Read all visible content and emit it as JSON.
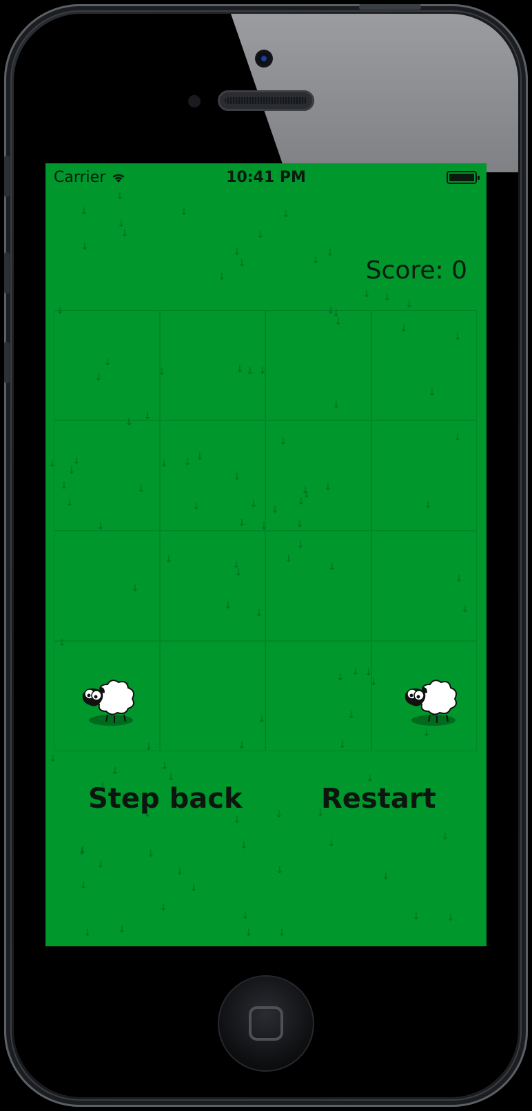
{
  "status_bar": {
    "carrier": "Carrier",
    "time": "10:41 PM",
    "wifi_icon": "wifi-icon",
    "battery_icon": "battery-icon"
  },
  "game": {
    "score_label": "Score: 0",
    "board": {
      "rows": 4,
      "cols": 4
    },
    "sheep_icon": "sheep-icon",
    "background_color": "#00972c"
  },
  "controls": {
    "step_back": "Step back",
    "restart": "Restart"
  }
}
